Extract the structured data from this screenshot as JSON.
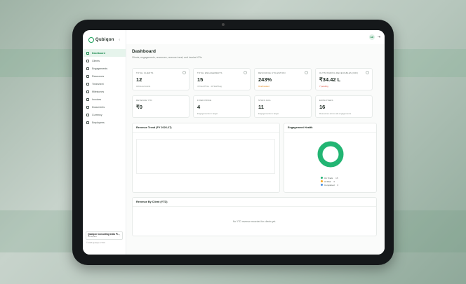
{
  "sidebar": {
    "logo": "Qubiqon",
    "collapse_label": "‹",
    "items": [
      {
        "label": "Dashboard",
        "icon": "dashboard-icon",
        "active": true
      },
      {
        "label": "Clients",
        "icon": "users-icon"
      },
      {
        "label": "Engagements",
        "icon": "briefcase-icon"
      },
      {
        "label": "Resources",
        "icon": "resources-icon"
      },
      {
        "label": "Timesheet",
        "icon": "clock-icon"
      },
      {
        "label": "Milestones",
        "icon": "flag-icon"
      },
      {
        "label": "Invoices",
        "icon": "invoice-icon"
      },
      {
        "label": "Documents",
        "icon": "document-icon"
      },
      {
        "label": "Currency",
        "icon": "currency-icon"
      },
      {
        "label": "Employees",
        "icon": "employees-icon"
      }
    ],
    "org": {
      "name": "Qubiqon Consulting India Pr...",
      "role": "Workspace"
    },
    "copyright": "© 2026 Qubiqon CTOS"
  },
  "topbar": {
    "avatar_initials": "AM",
    "logout_icon": "logout-icon"
  },
  "page": {
    "title": "Dashboard",
    "subtitle": "Clients, engagements, resources, revenue trend, and invoice KPIs"
  },
  "kpis": [
    {
      "label": "TOTAL CLIENTS",
      "value": "12",
      "note": "Active accounts",
      "tone": ""
    },
    {
      "label": "TOTAL ENGAGEMENTS",
      "value": "15",
      "note": "4 Fixed Price · 11 Staff Aug",
      "tone": ""
    },
    {
      "label": "RESOURCE UTILIZATION",
      "value": "243%",
      "note": "Overbooked",
      "tone": "warn"
    },
    {
      "label": "OUTSTANDING RECEIVABLES (INR)",
      "value": "₹34.42 L",
      "note": "7 pending",
      "tone": "danger"
    },
    {
      "label": "REVENUE YTD",
      "value": "₹0",
      "note": "",
      "tone": ""
    },
    {
      "label": "FIXED PRICE",
      "value": "4",
      "note": "Engagements in target",
      "tone": ""
    },
    {
      "label": "STAFF AUG",
      "value": "11",
      "note": "Engagements in target",
      "tone": ""
    },
    {
      "label": "EMPLOYEES",
      "value": "16",
      "note": "Resources across all engagements",
      "tone": ""
    }
  ],
  "revenue_trend": {
    "title": "Revenue Trend (FY 2026-27)"
  },
  "engagement_health": {
    "title": "Engagement Health",
    "legend": [
      {
        "label": "On Track",
        "count": "15",
        "color": "#22b573"
      },
      {
        "label": "At Risk",
        "count": "0",
        "color": "#f5a623"
      },
      {
        "label": "Completed",
        "count": "0",
        "color": "#4a90e2"
      }
    ],
    "on_track_fraction": 1.0
  },
  "revenue_by_client": {
    "title": "Revenue By Client (YTD)",
    "empty_message": "No YTD revenue recorded for clients yet."
  },
  "colors": {
    "brand": "#1aa05a",
    "donut": "#22b573"
  }
}
